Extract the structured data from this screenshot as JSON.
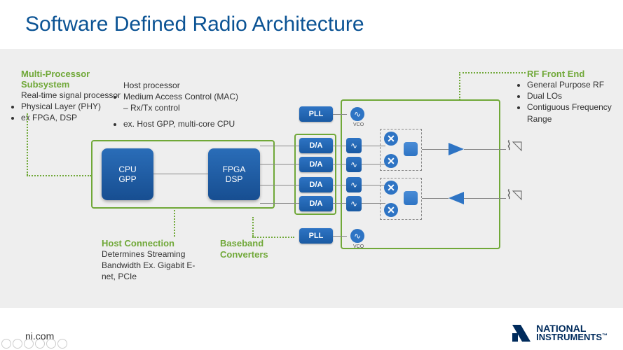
{
  "title": "Software Defined Radio Architecture",
  "callouts": {
    "mp": {
      "heading": "Multi-Processor Subsystem",
      "sub1_title": "Real-time signal processor",
      "sub1_items": [
        "Physical Layer (PHY)",
        "ex FPGA, DSP"
      ],
      "sub2_title": "Host processor",
      "sub2_items": [
        "Medium Access Control (MAC) – Rx/Tx control",
        "ex. Host GPP, multi-core CPU"
      ]
    },
    "host": {
      "heading": "Host Connection",
      "body": "Determines Streaming Bandwidth Ex. Gigabit E-net, PCIe"
    },
    "baseband": {
      "heading": "Baseband Converters"
    },
    "rf": {
      "heading": "RF Front End",
      "items": [
        "General Purpose RF",
        "Dual LOs",
        "Contiguous Frequency Range"
      ]
    }
  },
  "blocks": {
    "cpu": {
      "line1": "CPU",
      "line2": "GPP"
    },
    "fpga": {
      "line1": "FPGA",
      "line2": "DSP"
    },
    "pll_top": "PLL",
    "pll_bot": "PLL",
    "da": "D/A",
    "vco": "VCO"
  },
  "symbols": {
    "filter": "∿",
    "mixer": "✕",
    "amp_right": "▶",
    "amp_left": "◀",
    "antenna": "📶"
  },
  "footer": "ni.com",
  "logo": {
    "brand_top": "NATIONAL",
    "brand_bot": "INSTRUMENTS"
  }
}
